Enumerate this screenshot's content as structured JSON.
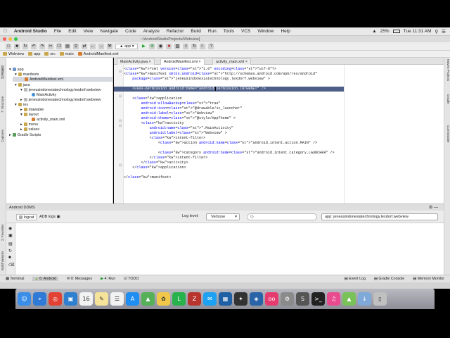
{
  "menubar": {
    "apple_icon": "apple-icon",
    "app_name": "Android Studio",
    "items": [
      "File",
      "Edit",
      "View",
      "Navigate",
      "Code",
      "Analyze",
      "Refactor",
      "Build",
      "Run",
      "Tools",
      "VCS",
      "Window",
      "Help"
    ],
    "battery": "25%",
    "clock": "Tue 11:31 AM"
  },
  "titlebar": {
    "title": "~/AndroidStudioProjects/Webview]"
  },
  "toolbar": {
    "run_config": "app"
  },
  "breadcrumbs": [
    "Webview",
    "app",
    "src",
    "main",
    "AndroidManifest.xml"
  ],
  "side_tabs_left": [
    "1: Project",
    "7: Structure",
    "Captures",
    "2: Favorites",
    "Build Variants"
  ],
  "side_tabs_right": [
    "Maven Projects",
    "Gradle",
    "Commander"
  ],
  "project_tree": [
    {
      "label": "app",
      "depth": 0,
      "kind": "module"
    },
    {
      "label": "manifests",
      "depth": 1,
      "kind": "folder"
    },
    {
      "label": "AndroidManifest.xml",
      "depth": 2,
      "kind": "xml",
      "selected": true
    },
    {
      "label": "java",
      "depth": 1,
      "kind": "folder"
    },
    {
      "label": "jeneusindonesiatechnology.lexdorf.webview",
      "depth": 2,
      "kind": "package"
    },
    {
      "label": "MainActivity",
      "depth": 3,
      "kind": "class"
    },
    {
      "label": "jeneusindonesiatechnology.lexdorf.webview",
      "depth": 2,
      "kind": "package"
    },
    {
      "label": "res",
      "depth": 1,
      "kind": "folder"
    },
    {
      "label": "drawable",
      "depth": 2,
      "kind": "folder"
    },
    {
      "label": "layout",
      "depth": 2,
      "kind": "folder"
    },
    {
      "label": "activity_main.xml",
      "depth": 3,
      "kind": "xml"
    },
    {
      "label": "menu",
      "depth": 2,
      "kind": "folder"
    },
    {
      "label": "values",
      "depth": 2,
      "kind": "folder"
    },
    {
      "label": "Gradle Scripts",
      "depth": 0,
      "kind": "gradle"
    }
  ],
  "editor_tabs": [
    {
      "label": "MainActivity.java",
      "active": false
    },
    {
      "label": "AndroidManifest.xml",
      "active": true
    },
    {
      "label": "activity_main.xml",
      "active": false
    }
  ],
  "code_lines": [
    {
      "text": "<?xml version=\"1.0\" encoding=\"utf-8\"?>",
      "highlight": false
    },
    {
      "text": "<manifest xmlns:android=\"http://schemas.android.com/apk/res/android\"",
      "highlight": false
    },
    {
      "text": "    package=\"jeneusindonesiatechnology.lexdorf.webview\" >",
      "highlight": false
    },
    {
      "text": "",
      "highlight": false
    },
    {
      "text": "    <uses-permission android:name=\"android.permission.INTERNET\" />",
      "highlight": true
    },
    {
      "text": "",
      "highlight": false
    },
    {
      "text": "    <application",
      "highlight": false
    },
    {
      "text": "        android:allowBackup=\"true\"",
      "highlight": false
    },
    {
      "text": "        android:icon=\"@drawable/ic_launcher\"",
      "highlight": false
    },
    {
      "text": "        android:label=\"Webview\"",
      "highlight": false
    },
    {
      "text": "        android:theme=\"@style/AppTheme\" >",
      "highlight": false
    },
    {
      "text": "        <activity",
      "highlight": false
    },
    {
      "text": "            android:name=\".MainActivity\"",
      "highlight": false
    },
    {
      "text": "            android:label=\"Webview\" >",
      "highlight": false
    },
    {
      "text": "            <intent-filter>",
      "highlight": false
    },
    {
      "text": "                <action android:name=\"android.intent.action.MAIN\" />",
      "highlight": false
    },
    {
      "text": "",
      "highlight": false
    },
    {
      "text": "                <category android:name=\"android.intent.category.LAUNCHER\" />",
      "highlight": false
    },
    {
      "text": "            </intent-filter>",
      "highlight": false
    },
    {
      "text": "        </activity>",
      "highlight": false
    },
    {
      "text": "    </application>",
      "highlight": false
    },
    {
      "text": "",
      "highlight": false
    },
    {
      "text": "</manifest>",
      "highlight": false
    }
  ],
  "bottom_panel": {
    "title": "Android DDMS",
    "tab_logcat": "logcat",
    "tab_adb": "ADB logs",
    "log_level_label": "Log level:",
    "log_level_value": "Verbose",
    "search_placeholder": "Q-",
    "filter_value": "app: jeneusindonesiatechnology.lexdorf.webview"
  },
  "tool_windows": [
    {
      "label": "Terminal",
      "icon": "terminal-icon"
    },
    {
      "label": "6: Android",
      "icon": "android-icon"
    },
    {
      "label": "0: Messages",
      "icon": "messages-icon"
    },
    {
      "label": "4: Run",
      "icon": "run-icon"
    },
    {
      "label": "TODO",
      "icon": "todo-icon"
    },
    {
      "label": "Event Log",
      "icon": "event-log-icon"
    },
    {
      "label": "Gradle Console",
      "icon": "gradle-console-icon"
    },
    {
      "label": "Memory Monitor",
      "icon": "memory-monitor-icon"
    }
  ],
  "colors": {
    "selection": "#4d5f88",
    "tree_selection": "#d5d8df",
    "xml_tag": "#000080",
    "xml_attr": "#0000ff",
    "xml_string": "#008000"
  },
  "dock": [
    "finder-icon",
    "safari-icon",
    "chrome-icon",
    "preview-icon",
    "calendar-icon",
    "notes-icon",
    "reminders-icon",
    "app-store-icon",
    "maps-icon",
    "photos-icon",
    "line-icon",
    "filezilla-icon",
    "twitter-icon",
    "virtualbox-icon",
    "unity-icon",
    "sourcetree-icon",
    "flickr-icon",
    "system-preferences-icon",
    "sublime-icon",
    "terminal-icon",
    "itunes-icon",
    "android-studio-icon",
    "downloads-icon",
    "trash-icon"
  ]
}
